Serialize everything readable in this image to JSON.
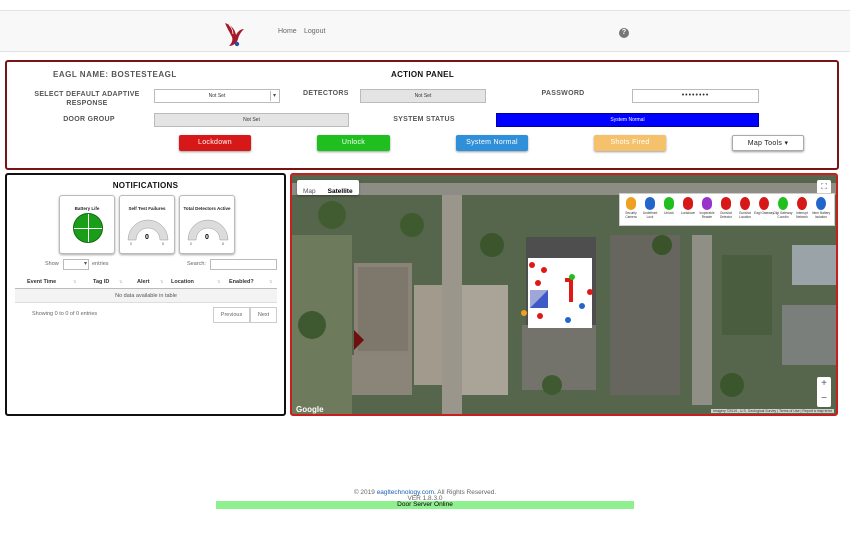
{
  "nav": {
    "home": "Home",
    "logout": "Logout",
    "help": "?"
  },
  "action_panel": {
    "eagl_name": "EAGL NAME: BOSTESTEAGL",
    "title": "ACTION PANEL",
    "adaptive_label": "SELECT DEFAULT ADAPTIVE RESPONSE",
    "adaptive_value": "Not Set",
    "detectors_label": "DETECTORS",
    "detectors_value": "Not Set",
    "password_label": "PASSWORD",
    "password_value": "••••••••",
    "door_group_label": "DOOR GROUP",
    "door_group_value": "Not Set",
    "system_status_label": "SYSTEM STATUS",
    "system_status_value": "System Normal",
    "buttons": {
      "lockdown": "Lockdown",
      "unlock": "Unlock",
      "system_normal": "System Normal",
      "shots_fired": "Shots Fired",
      "map_tools": "Map Tools ▾"
    },
    "colors": {
      "lockdown": "#d61818",
      "unlock": "#1fbf1f",
      "system_normal": "#2f8fd8",
      "shots_fired": "#f5c26b",
      "status": "#0000ff"
    }
  },
  "notifications": {
    "title": "NOTIFICATIONS",
    "gauges": [
      {
        "label": "Battery Life"
      },
      {
        "label": "Self Test Failures",
        "value": "0",
        "min": "0",
        "max": "5"
      },
      {
        "label": "Total Detectors Active",
        "value": "0",
        "min": "0",
        "max": "5"
      }
    ],
    "show_label": "Show",
    "entries_label": "entries",
    "search_label": "Search:",
    "columns": [
      "Event Time",
      "Tag ID",
      "Alert",
      "Location",
      "Enabled?"
    ],
    "empty_message": "No data available in table",
    "info": "Showing 0 to 0 of 0 entries",
    "previous": "Previous",
    "next": "Next"
  },
  "map": {
    "map_tab": "Map",
    "satellite_tab": "Satellite",
    "google": "Google",
    "attribution": "Imagery ©2019 , U.S. Geological Survey | Terms of Use | Report a map error",
    "legend": [
      {
        "label": "Security Camera",
        "color": "#f0a020"
      },
      {
        "label": "Undefined Lock",
        "color": "#2266cc"
      },
      {
        "label": "Unlock",
        "color": "#1fbf1f"
      },
      {
        "label": "Lockdown",
        "color": "#d61818"
      },
      {
        "label": "Inoperable Reader",
        "color": "#9933cc"
      },
      {
        "label": "Gunshot Detector",
        "color": "#d61818"
      },
      {
        "label": "Gunshot Location",
        "color": "#d61818"
      },
      {
        "label": "Eagl Gateway",
        "color": "#d61818"
      },
      {
        "label": "Digi Gateway Coordin",
        "color": "#1fbf1f"
      },
      {
        "label": "Interrupt Network",
        "color": "#d61818"
      },
      {
        "label": "Intrm Battery Isolation",
        "color": "#2266cc"
      }
    ]
  },
  "footer": {
    "copyright_pre": "© 2019",
    "company": "eagltechnology.com",
    "rights": ". All Rights Reserved.",
    "version": "VER 1.8.3.0",
    "server_status": "Door Server Online"
  }
}
